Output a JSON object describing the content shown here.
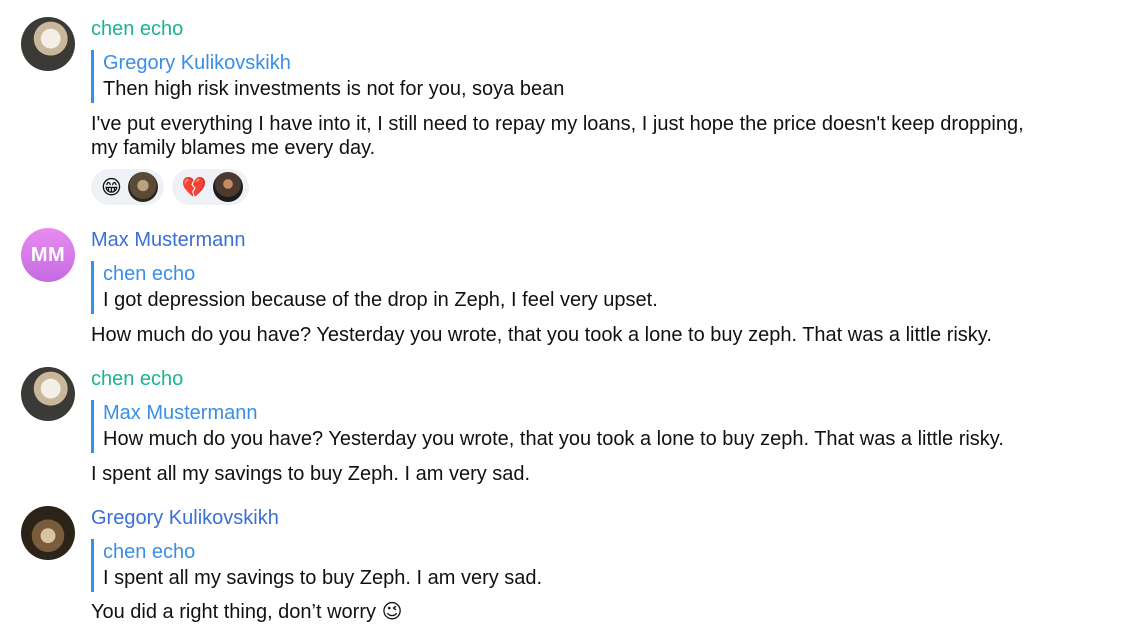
{
  "colors": {
    "accent": "#3390ec",
    "name_teal": "#1ab394",
    "name_blue": "#3a6fd6",
    "reply_name": "#3a8ee6",
    "reaction_bg": "#eef2f7"
  },
  "messages": [
    {
      "sender": "chen echo",
      "reply_name": "Gregory Kulikovskikh",
      "reply_text": "Then high risk investments is not for you, soya bean",
      "body_line1": "I've put everything I have into it, I still need to repay my loans, I just hope the price doesn't keep dropping,",
      "body_line2": "my family blames me every day.",
      "reactions": [
        {
          "emoji": "😁",
          "icon": "grinning-face-emoji"
        },
        {
          "emoji": "💔",
          "icon": "broken-heart-emoji"
        }
      ]
    },
    {
      "sender": "Max Mustermann",
      "avatar_initials": "MM",
      "reply_name": "chen echo",
      "reply_text": "I got depression because of the drop in Zeph, I feel very upset.",
      "body": "How much do you have? Yesterday you wrote, that you took a lone to buy zeph. That was a little risky."
    },
    {
      "sender": "chen echo",
      "reply_name": "Max Mustermann",
      "reply_text": "How much do you have? Yesterday you wrote, that you took a lone to buy zeph. That was a little risky.",
      "body": "I spent all my savings to buy Zeph. I am very sad."
    },
    {
      "sender": "Gregory Kulikovskikh",
      "reply_name": "chen echo",
      "reply_text": "I spent all my savings to buy Zeph. I am very sad.",
      "body": "You did a right thing, don’t worry",
      "body_emoji": "😉"
    }
  ]
}
